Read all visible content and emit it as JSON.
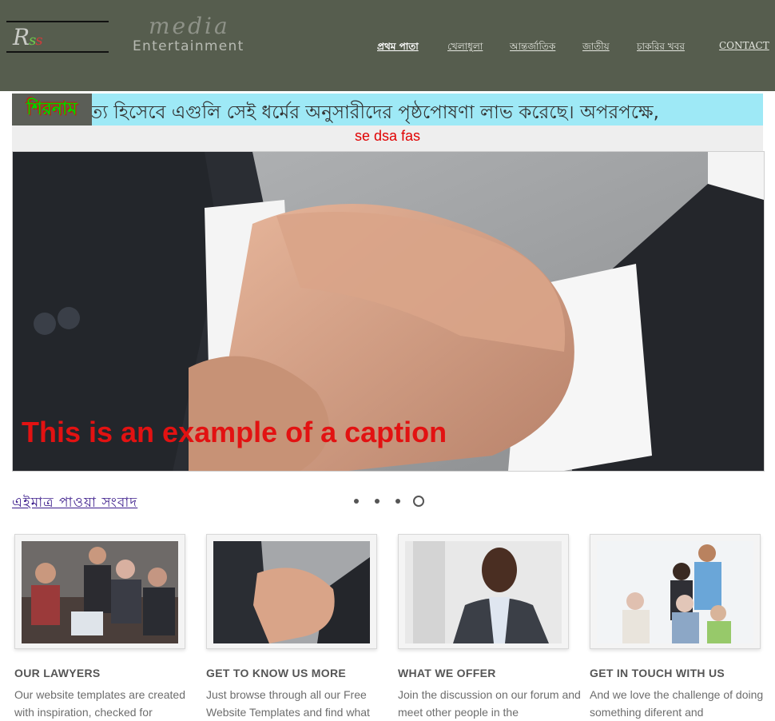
{
  "header": {
    "logo_main": "R",
    "logo_s1": "s",
    "logo_s2": "s",
    "brand_top": "media",
    "brand_bottom": "Entertainment",
    "nav": [
      {
        "label": "প্রথম পাতা",
        "active": true
      },
      {
        "label": "খেলাধুলা"
      },
      {
        "label": "আন্তর্জাতিক"
      },
      {
        "label": "জাতীয়"
      },
      {
        "label": "চাকরির খবর"
      },
      {
        "label": "CONTACT"
      }
    ]
  },
  "ticker": {
    "badge": "শিরনাম",
    "text": "ত্য হিসেবে এগুলি সেই ধর্মের অনুসারীদের পৃষ্ঠপোষণা লাভ করেছে। অপরপক্ষে,",
    "subtext": "se dsa fas"
  },
  "slider": {
    "caption": "This is an example of a caption",
    "slide_count": 4,
    "active_slide": 4
  },
  "section": {
    "title": "এইমাত্র পাওয়া সংবাদ"
  },
  "cards": [
    {
      "title": "OUR LAWYERS",
      "text": "Our website templates are created with inspiration, checked for"
    },
    {
      "title": "GET TO KNOW US MORE",
      "text": "Just browse through all our Free Website Templates and find what"
    },
    {
      "title": "WHAT WE OFFER",
      "text": "Join the discussion on our forum and meet other people in the"
    },
    {
      "title": "GET IN TOUCH WITH US",
      "text": "And we love the challenge of doing something diferent and"
    }
  ],
  "colors": {
    "header_bg": "#565d4e",
    "ticker_bg": "#9ee9f6",
    "caption": "#e21212",
    "section_title": "#3a1a8a"
  }
}
